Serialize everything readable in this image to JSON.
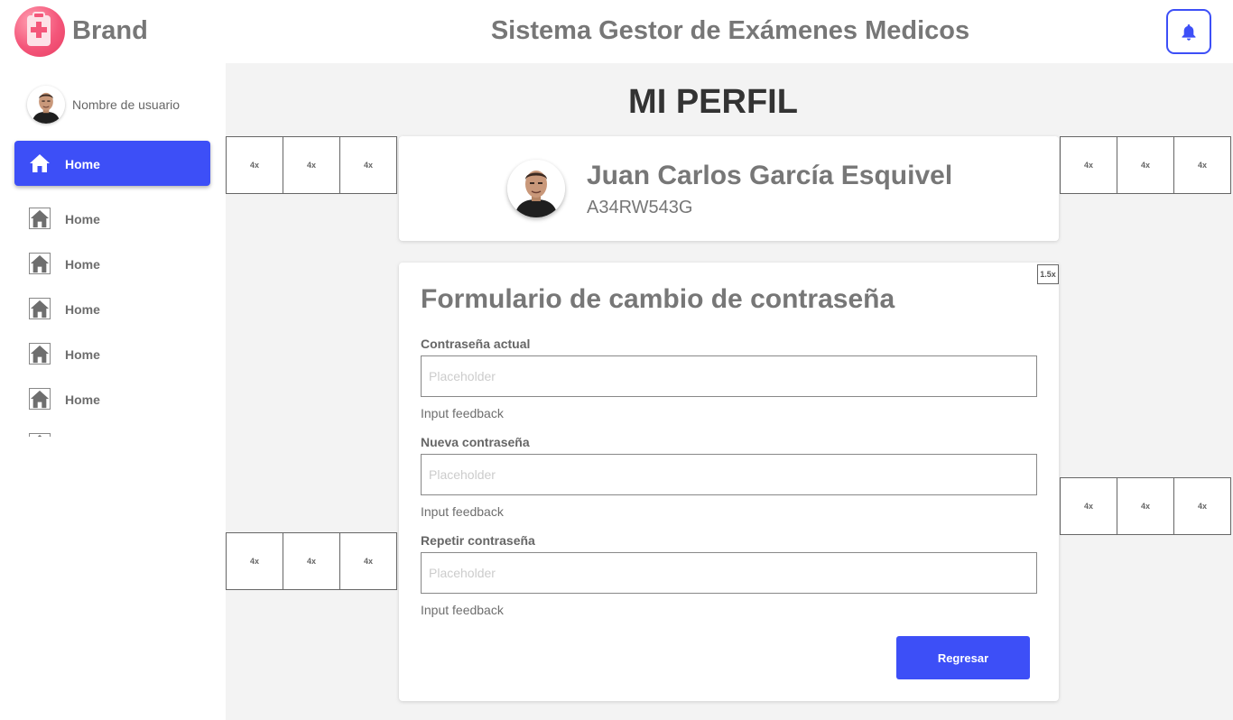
{
  "header": {
    "brand": "Brand",
    "title": "Sistema Gestor de Exámenes Medicos",
    "notification_icon": "bell-icon",
    "accent": "#3d4ff7"
  },
  "sidebar": {
    "username": "Nombre de usuario",
    "active_item": {
      "label": "Home",
      "icon": "home-icon"
    },
    "items": [
      {
        "label": "Home",
        "icon": "home-icon"
      },
      {
        "label": "Home",
        "icon": "home-icon"
      },
      {
        "label": "Home",
        "icon": "home-icon"
      },
      {
        "label": "Home",
        "icon": "home-icon"
      },
      {
        "label": "Home",
        "icon": "home-icon"
      }
    ]
  },
  "main": {
    "page_title": "MI PERFIL",
    "placeholder_label": "4x",
    "zoom_badge": "1.5x",
    "profile": {
      "name": "Juan Carlos García Esquivel",
      "id": "A34RW543G"
    },
    "form": {
      "title": "Formulario de cambio de contraseña",
      "fields": [
        {
          "label": "Contraseña actual",
          "placeholder": "Placeholder",
          "feedback": "Input feedback"
        },
        {
          "label": "Nueva contraseña",
          "placeholder": "Placeholder",
          "feedback": "Input feedback"
        },
        {
          "label": "Repetir contraseña",
          "placeholder": "Placeholder",
          "feedback": "Input feedback"
        }
      ],
      "back_button": "Regresar"
    }
  }
}
